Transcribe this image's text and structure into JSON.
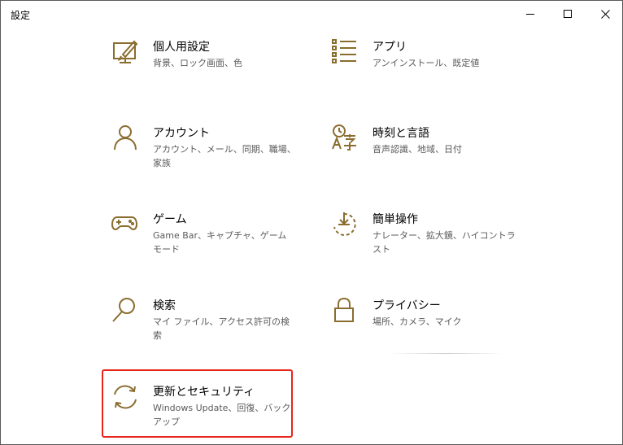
{
  "window": {
    "title": "設定",
    "minimize_icon": "minimize-icon",
    "maximize_icon": "maximize-icon",
    "close_icon": "close-icon"
  },
  "colors": {
    "accent_icon": "#8a6d2f",
    "highlight_border": "#e8251a",
    "desc_text": "#5a5a5a"
  },
  "tiles": [
    {
      "title": "個人用設定",
      "desc": "背景、ロック画面、色",
      "icon": "personalization-icon"
    },
    {
      "title": "アプリ",
      "desc": "アンインストール、既定値",
      "icon": "apps-icon"
    },
    {
      "title": "アカウント",
      "desc": "アカウント、メール、同期、職場、家族",
      "icon": "account-icon"
    },
    {
      "title": "時刻と言語",
      "desc": "音声認識、地域、日付",
      "icon": "time-language-icon"
    },
    {
      "title": "ゲーム",
      "desc": "Game Bar、キャプチャ、ゲーム モード",
      "icon": "gamepad-icon"
    },
    {
      "title": "簡単操作",
      "desc": "ナレーター、拡大鏡、ハイコントラスト",
      "icon": "ease-of-access-icon"
    },
    {
      "title": "検索",
      "desc": "マイ ファイル、アクセス許可の検索",
      "icon": "search-icon"
    },
    {
      "title": "プライバシー",
      "desc": "場所、カメラ、マイク",
      "icon": "lock-icon"
    },
    {
      "title": "更新とセキュリティ",
      "desc": "Windows Update、回復、バックアップ",
      "icon": "update-sync-icon"
    }
  ]
}
